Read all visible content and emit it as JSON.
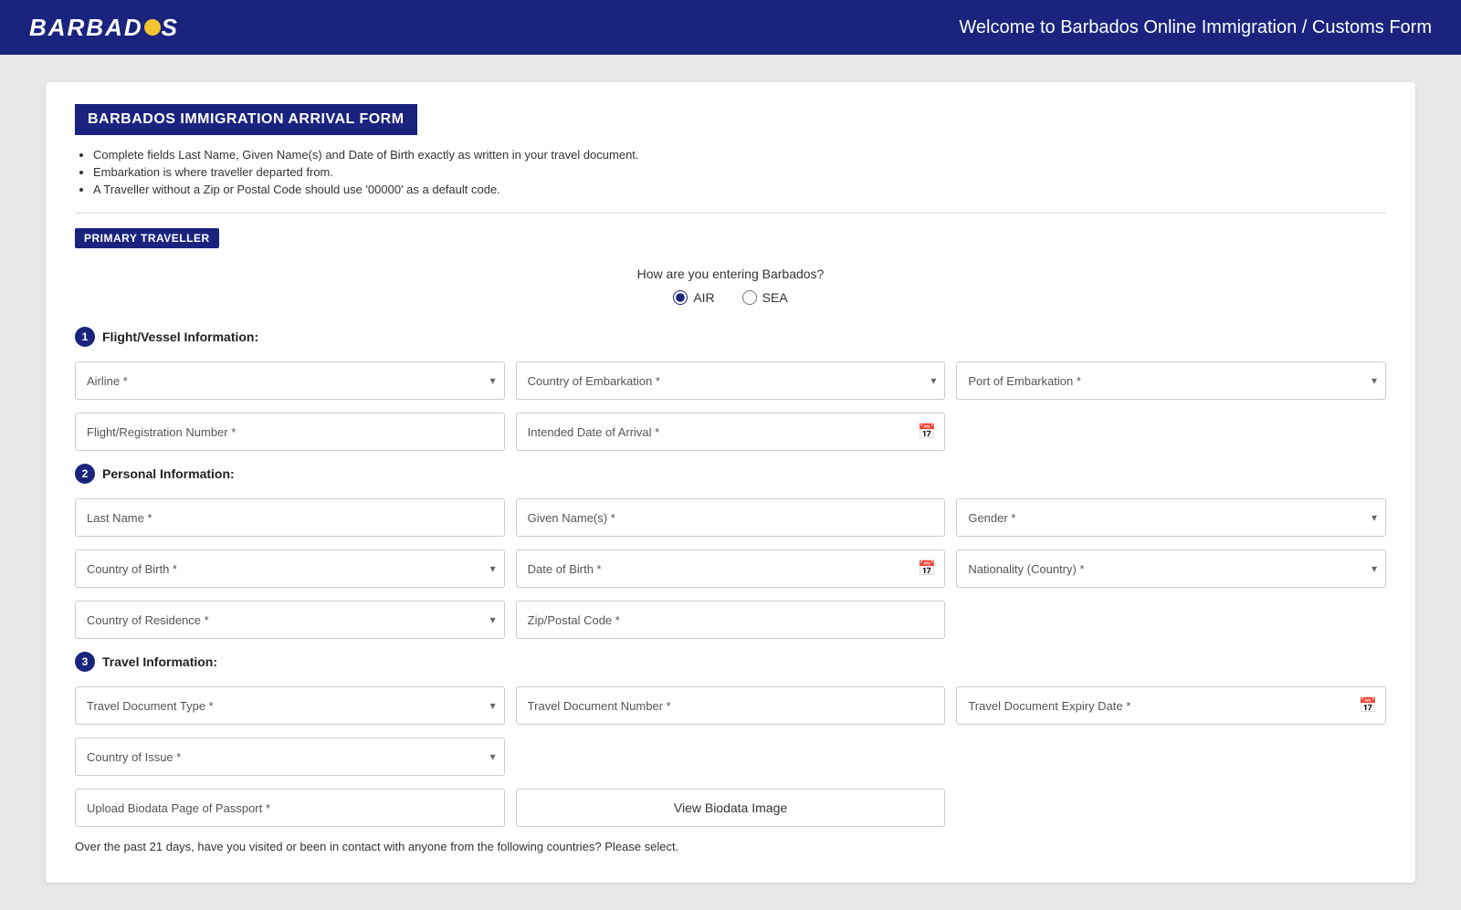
{
  "header": {
    "logo_text": "BARBAD S",
    "title": "Welcome to Barbados Online Immigration / Customs Form"
  },
  "form": {
    "title": "BARBADOS IMMIGRATION ARRIVAL FORM",
    "instructions": [
      "Complete fields Last Name, Given Name(s) and Date of Birth exactly as written in your travel document.",
      "Embarkation is where traveller departed from.",
      "A Traveller without a Zip or Postal Code should use '00000' as a default code."
    ],
    "primary_traveller_label": "PRIMARY TRAVELLER",
    "entry_mode": {
      "question": "How are you entering Barbados?",
      "options": [
        "AIR",
        "SEA"
      ],
      "selected": "AIR"
    },
    "sections": {
      "flight_vessel": {
        "number": "1",
        "label": "Flight/Vessel Information:",
        "fields": {
          "airline_label": "Airline *",
          "country_embarkation_label": "Country of Embarkation *",
          "port_embarkation_label": "Port of Embarkation *",
          "flight_registration_label": "Flight/Registration Number *",
          "intended_arrival_label": "Intended Date of Arrival *"
        }
      },
      "personal": {
        "number": "2",
        "label": "Personal Information:",
        "fields": {
          "last_name_label": "Last Name *",
          "given_names_label": "Given Name(s) *",
          "gender_label": "Gender *",
          "country_birth_label": "Country of Birth *",
          "date_birth_label": "Date of Birth *",
          "nationality_label": "Nationality (Country) *",
          "country_residence_label": "Country of Residence *",
          "zip_postal_label": "Zip/Postal Code *"
        }
      },
      "travel": {
        "number": "3",
        "label": "Travel Information:",
        "fields": {
          "doc_type_label": "Travel Document Type *",
          "doc_number_label": "Travel Document Number *",
          "doc_expiry_label": "Travel Document Expiry Date *",
          "country_issue_label": "Country of Issue *",
          "upload_biodata_label": "Upload Biodata Page of Passport *",
          "view_biodata_btn": "View Biodata Image"
        }
      }
    },
    "bottom_note": "Over the past 21 days, have you visited or been in contact with anyone from the following countries? Please select."
  }
}
